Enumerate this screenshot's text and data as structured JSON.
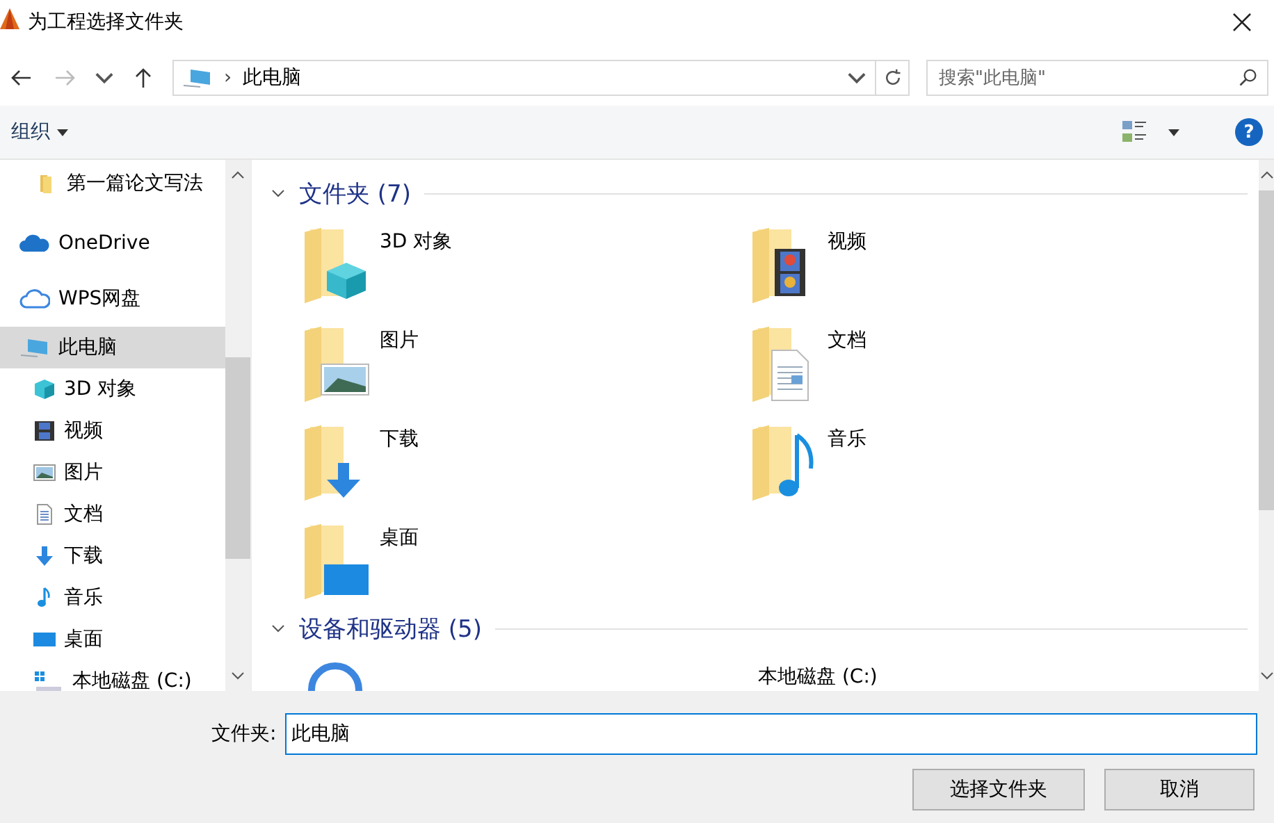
{
  "window": {
    "title": "为工程选择文件夹"
  },
  "address_bar": {
    "path": "此电脑",
    "separator": "›"
  },
  "search": {
    "placeholder": "搜索\"此电脑\""
  },
  "toolbar": {
    "organize": "组织",
    "help": "?"
  },
  "sidebar": {
    "items": [
      {
        "label": "第一篇论文写法",
        "kind": "folder",
        "selected": false
      },
      {
        "label": "OneDrive",
        "kind": "onedrive",
        "selected": false
      },
      {
        "label": "WPS网盘",
        "kind": "wps",
        "selected": false
      },
      {
        "label": "此电脑",
        "kind": "pc",
        "selected": true,
        "children": [
          {
            "label": "3D 对象",
            "kind": "objects",
            "selected": false
          },
          {
            "label": "视频",
            "kind": "video",
            "selected": false
          },
          {
            "label": "图片",
            "kind": "pictures",
            "selected": false
          },
          {
            "label": "文档",
            "kind": "docs",
            "selected": false
          },
          {
            "label": "下载",
            "kind": "downloads",
            "selected": false
          },
          {
            "label": "音乐",
            "kind": "music",
            "selected": false
          },
          {
            "label": "桌面",
            "kind": "desktop",
            "selected": false
          },
          {
            "label": "本地磁盘 (C:)",
            "kind": "drive",
            "selected": false
          }
        ]
      }
    ]
  },
  "sections": [
    {
      "title": "文件夹 (7)",
      "expanded": true,
      "items": [
        {
          "name": "3D 对象",
          "kind": "objects"
        },
        {
          "name": "视频",
          "kind": "video"
        },
        {
          "name": "图片",
          "kind": "pictures"
        },
        {
          "name": "文档",
          "kind": "docs"
        },
        {
          "name": "下载",
          "kind": "downloads"
        },
        {
          "name": "音乐",
          "kind": "music"
        },
        {
          "name": "桌面",
          "kind": "desktop"
        }
      ]
    },
    {
      "title": "设备和驱动器 (5)",
      "expanded": true,
      "items": [
        {
          "kind": "wps"
        },
        {
          "name": "本地磁盘 (C:)",
          "kind": "drive"
        }
      ]
    }
  ],
  "footer": {
    "label": "文件夹:",
    "value": "此电脑",
    "buttons": [
      "选择文件夹",
      "取消"
    ]
  }
}
